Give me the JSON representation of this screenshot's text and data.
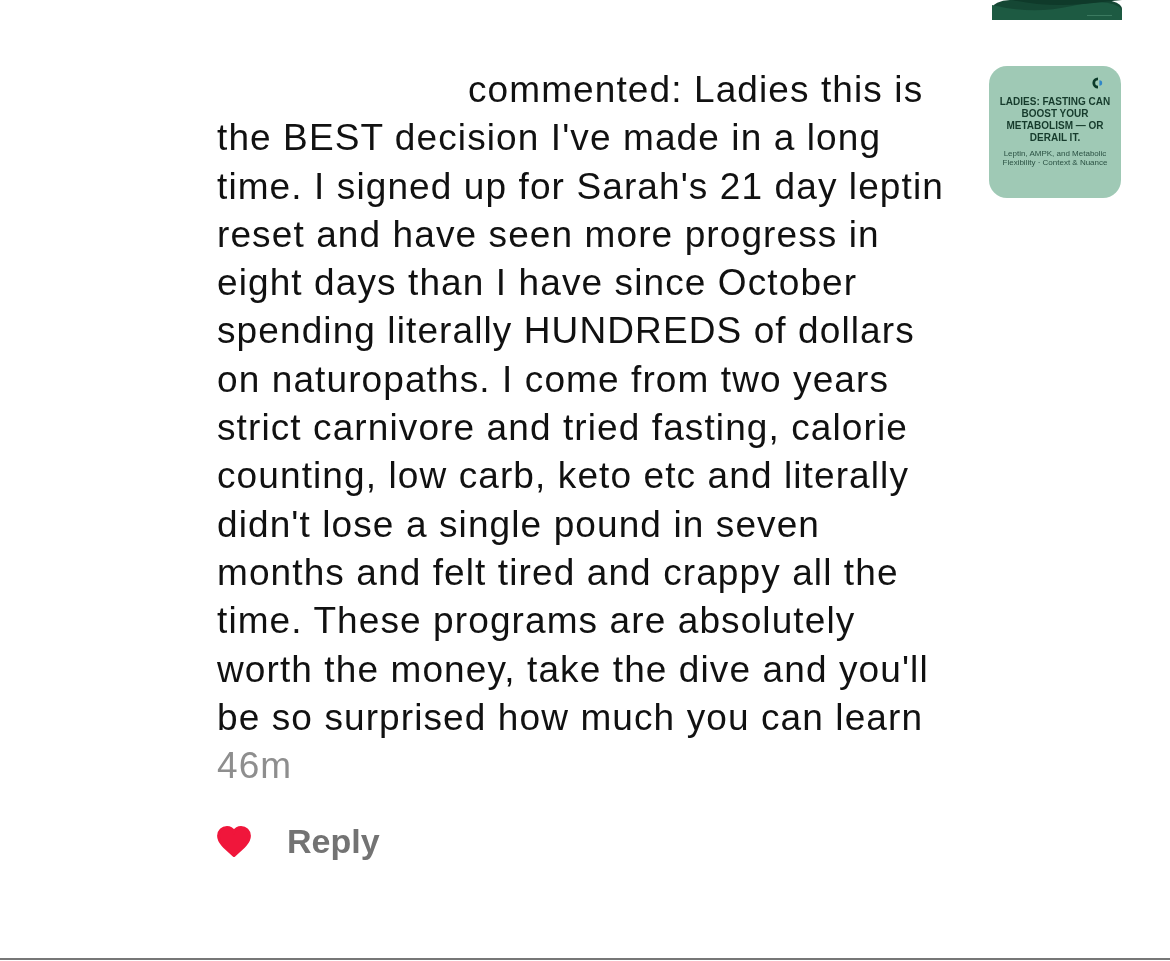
{
  "notification": {
    "action": "commented:",
    "comment": "Ladies this is the BEST decision I've made in a long time.  I signed up for Sarah's 21 day leptin reset and have seen more progress in eight days than I have since October spending literally HUNDREDS of dollars on naturopaths. I come from two years strict carnivore and tried fasting, calorie counting, low carb, keto etc and literally didn't lose a single pound in seven months and felt tired and crappy all the time. These programs are absolutely worth the money, take the dive and you'll be so surprised how much you can learn",
    "time": "46m",
    "liked": true,
    "reply_label": "Reply",
    "thumbnail": {
      "headline": "LADIES: FASTING CAN BOOST YOUR METABOLISM — OR DERAIL IT.",
      "subtitle": "Leptin, AMPK, and Metabolic Flexibility · Context & Nuance"
    }
  }
}
